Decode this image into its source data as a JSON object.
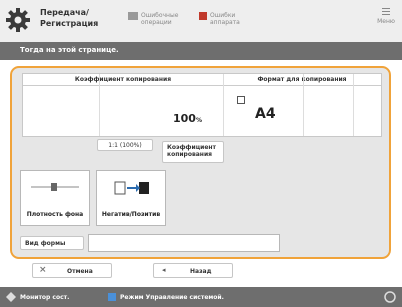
{
  "header": {
    "title_line1": "Передача/",
    "title_line2": "Регистрация",
    "status1": "Ошибочные операции",
    "status2": "Ошибки аппарата",
    "menu_label": "Меню"
  },
  "subheader": {
    "title": "Тогда на этой странице."
  },
  "table": {
    "col1_header": "Коэффициент копирования",
    "col2_header": "Формат для копирования",
    "ratio_value": "100",
    "ratio_unit": "%",
    "paper_size": "A4"
  },
  "buttons": {
    "ratio_preset": "1:1 (100%)",
    "ratio_copy_label": "Коэффициент копирования",
    "density_label": "Плотность фона",
    "orientation_label": "Негатив/Позитив",
    "type_label": "Вид формы"
  },
  "actions": {
    "cancel": "Отмена",
    "back": "Назад"
  },
  "footer": {
    "left": "Монитор сост.",
    "right": "Режим Управление системой."
  },
  "colors": {
    "accent": "#f0a33a",
    "bar": "#6e6e6e"
  }
}
